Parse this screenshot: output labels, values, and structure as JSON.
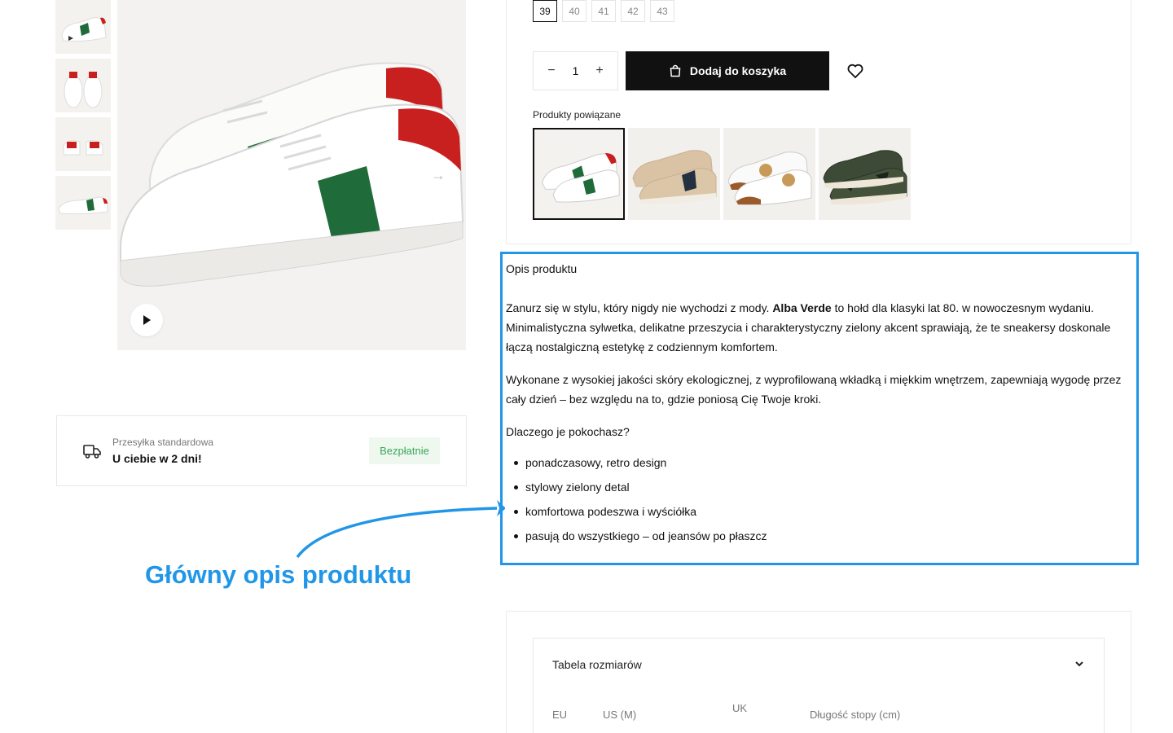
{
  "sizes": {
    "items": [
      "39",
      "40",
      "41",
      "42",
      "43"
    ],
    "selected": "39"
  },
  "quantity": {
    "minus": "−",
    "value": "1",
    "plus": "+"
  },
  "cart": {
    "add_label": "Dodaj do koszyka"
  },
  "related": {
    "label": "Produkty powiązane"
  },
  "description": {
    "heading": "Opis produktu",
    "p1_before": "Zanurz się w stylu, który nigdy nie wychodzi z mody. ",
    "p1_bold": "Alba Verde",
    "p1_after": " to hołd dla klasyki lat 80. w nowoczesnym wydaniu. Minimalistyczna sylwetka, delikatne przeszycia i charakterystyczny zielony akcent sprawiają, że te sneakersy doskonale łączą nostalgiczną estetykę z codziennym komfortem.",
    "p2": "Wykonane z wysokiej jakości skóry ekologicznej, z wyprofilowaną wkładką i miękkim wnętrzem, zapewniają wygodę przez cały dzień – bez względu na to, gdzie poniosą Cię Twoje kroki.",
    "p3": "Dlaczego je pokochasz?",
    "bullets": [
      "ponadczasowy, retro design",
      "stylowy zielony detal",
      "komfortowa podeszwa i wyściółka",
      "pasują do wszystkiego – od jeansów po płaszcz"
    ]
  },
  "shipping": {
    "title": "Przesyłka standardowa",
    "subtitle": "U ciebie w 2 dni!",
    "badge": "Bezpłatnie"
  },
  "annotation": {
    "label": "Główny opis produktu"
  },
  "size_table": {
    "title": "Tabela rozmiarów",
    "columns": [
      "EU",
      "US (M)",
      "UK",
      "Długość stopy (cm)"
    ]
  },
  "gallery": {
    "next_arrow": "→"
  },
  "colors": {
    "accent_annotation": "#2196e8",
    "button_dark": "#111111",
    "badge_green": "#3aa85a",
    "shoe_green": "#1f6b3a",
    "shoe_red": "#c8201e"
  }
}
